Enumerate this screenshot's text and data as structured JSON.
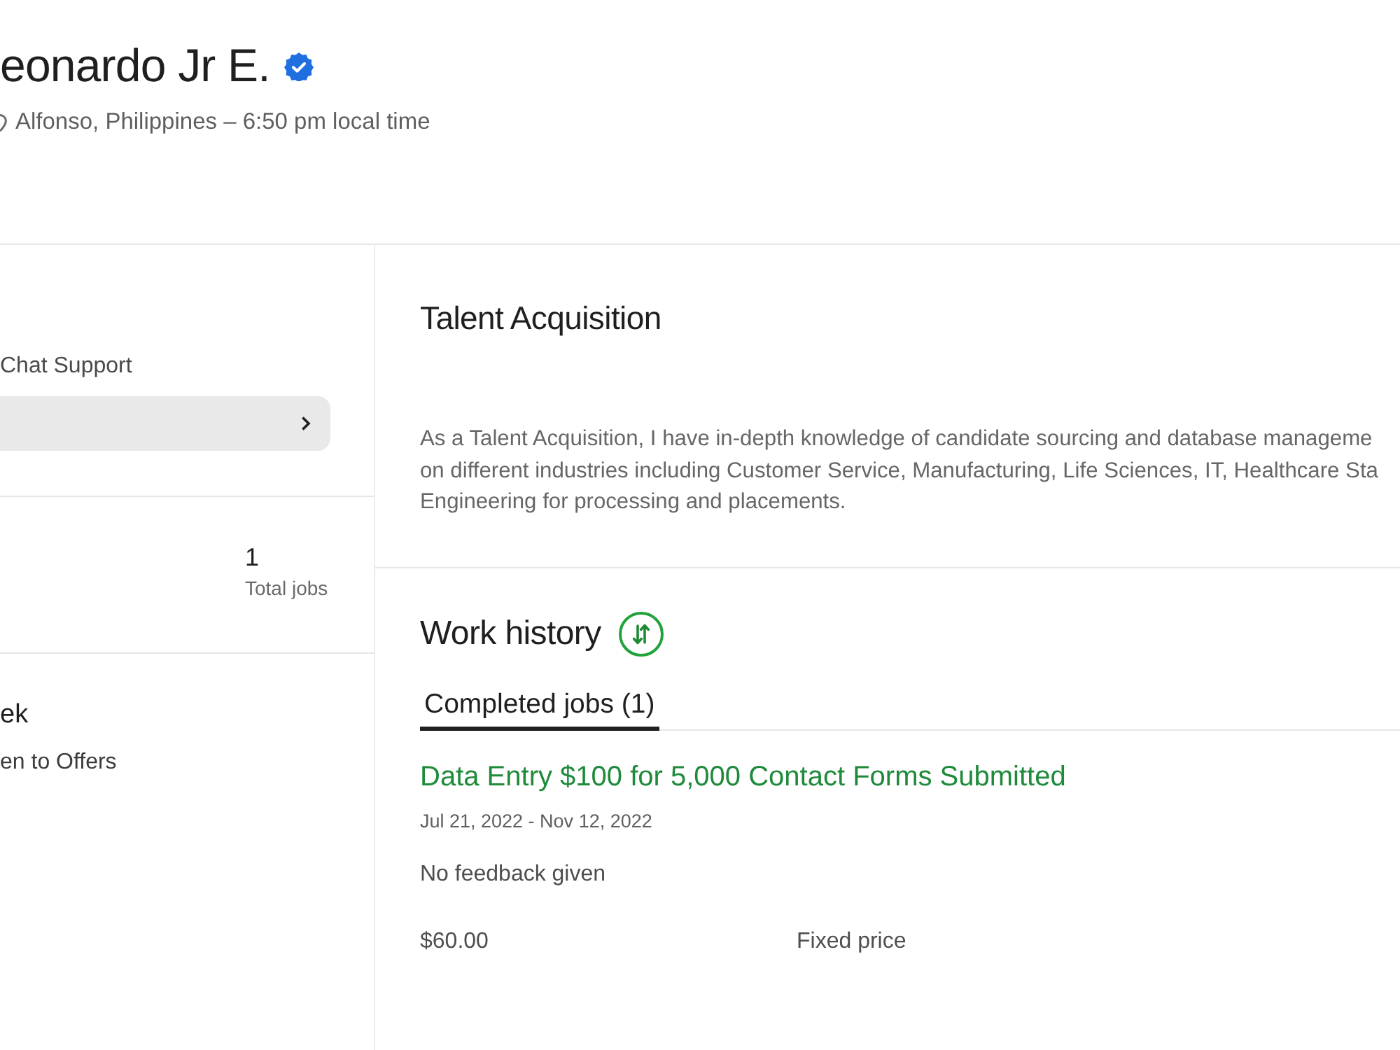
{
  "profile": {
    "name": "eonardo Jr E.",
    "verified": true,
    "location": "Alfonso, Philippines – 6:50 pm local time"
  },
  "sidebar": {
    "profiles": [
      {
        "label": "Chat Support",
        "selected": false
      },
      {
        "selected": true
      }
    ],
    "stats": [
      {
        "value": "1",
        "label": "Total jobs"
      }
    ],
    "availability": {
      "hours": "ek",
      "note": "en to Offers"
    }
  },
  "overview": {
    "title": "Talent Acquisition",
    "description_lines": [
      "As a Talent Acquisition, I have in-depth knowledge of candidate sourcing and database manageme",
      "on different industries including Customer Service, Manufacturing, Life Sciences, IT, Healthcare Sta",
      "Engineering for processing and placements."
    ]
  },
  "work_history": {
    "title": "Work history",
    "tabs": [
      {
        "label": "Completed jobs (1)",
        "selected": true
      }
    ],
    "jobs": [
      {
        "title": "Data Entry $100 for 5,000 Contact Forms Submitted",
        "dates": "Jul 21, 2022 - Nov 12, 2022",
        "feedback": "No feedback given",
        "amount": "$60.00",
        "price_type": "Fixed price"
      }
    ]
  }
}
